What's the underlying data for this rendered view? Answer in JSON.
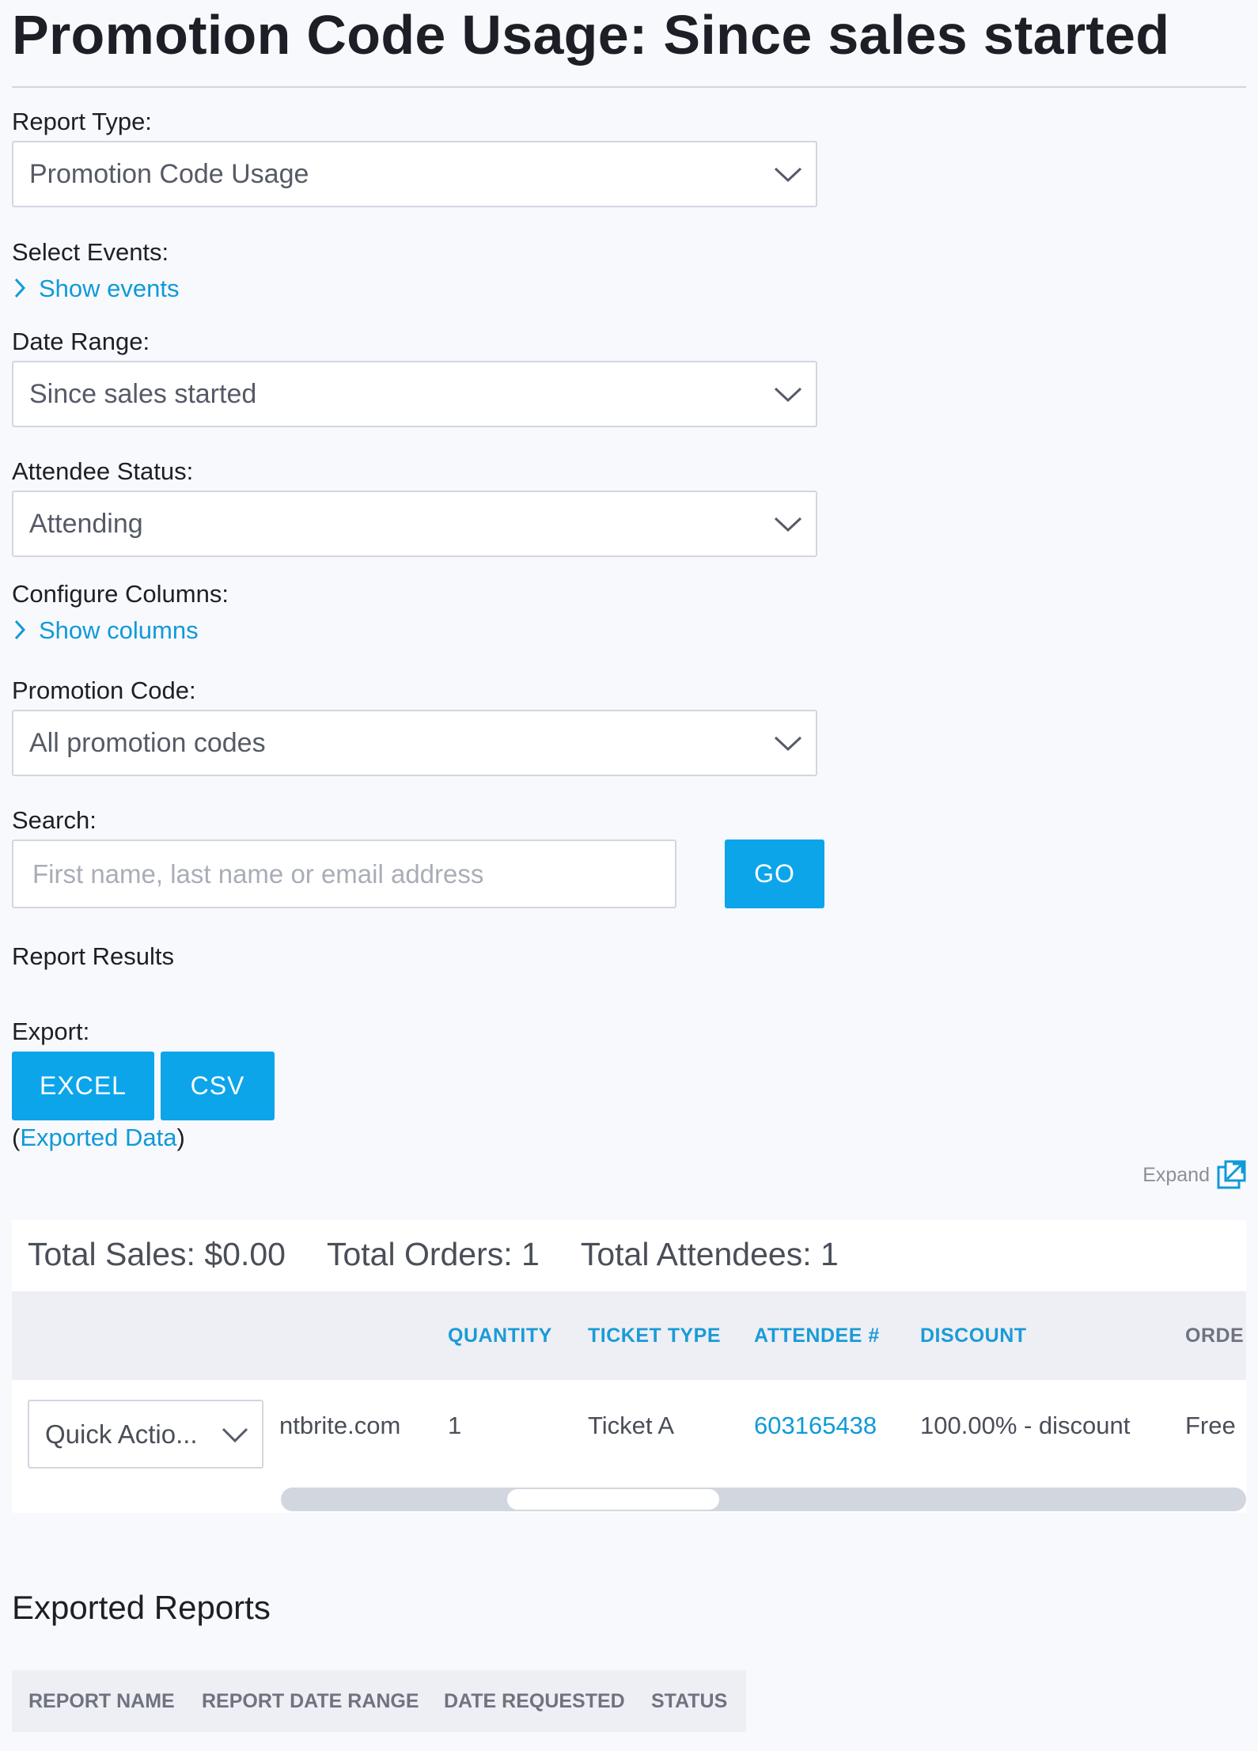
{
  "page": {
    "title": "Promotion Code Usage: Since sales started"
  },
  "filters": {
    "report_type": {
      "label": "Report Type:",
      "value": "Promotion Code Usage"
    },
    "select_events": {
      "label": "Select Events:",
      "toggle": "Show events"
    },
    "date_range": {
      "label": "Date Range:",
      "value": "Since sales started"
    },
    "attendee_status": {
      "label": "Attendee Status:",
      "value": "Attending"
    },
    "configure_columns": {
      "label": "Configure Columns:",
      "toggle": "Show columns"
    },
    "promotion_code": {
      "label": "Promotion Code:",
      "value": "All promotion codes"
    },
    "search": {
      "label": "Search:",
      "placeholder": "First name, last name or email address",
      "value": "",
      "button": "GO"
    }
  },
  "report_results": {
    "heading": "Report Results",
    "export_label": "Export:",
    "excel_button": "EXCEL",
    "csv_button": "CSV",
    "exported_data_open": "(",
    "exported_data_link": "Exported Data",
    "exported_data_close": ")",
    "expand_label": "Expand"
  },
  "totals": {
    "sales": "Total Sales: $0.00",
    "orders": "Total Orders: 1",
    "attendees": "Total Attendees: 1"
  },
  "table": {
    "columns": [
      "QUANTITY",
      "TICKET TYPE",
      "ATTENDEE #",
      "DISCOUNT",
      "ORDE"
    ],
    "row": {
      "action": "Quick Actio...",
      "email": "ntbrite.com",
      "quantity": "1",
      "ticket_type": "Ticket A",
      "attendee_number": "603165438",
      "discount": "100.00% - discount",
      "order": "Free"
    },
    "scroll_position": 0.3
  },
  "exported_reports": {
    "title": "Exported Reports",
    "columns": [
      "REPORT NAME",
      "REPORT DATE RANGE",
      "DATE REQUESTED",
      "STATUS"
    ]
  },
  "colors": {
    "accent": "#0ca5ea",
    "link": "#0f9ad8",
    "background": "#f8f9fd",
    "header_row": "#eeeff4"
  },
  "icons": {
    "dropdown": "chevron-down-icon",
    "toggle": "chevron-right-icon",
    "expand": "expand-icon"
  }
}
